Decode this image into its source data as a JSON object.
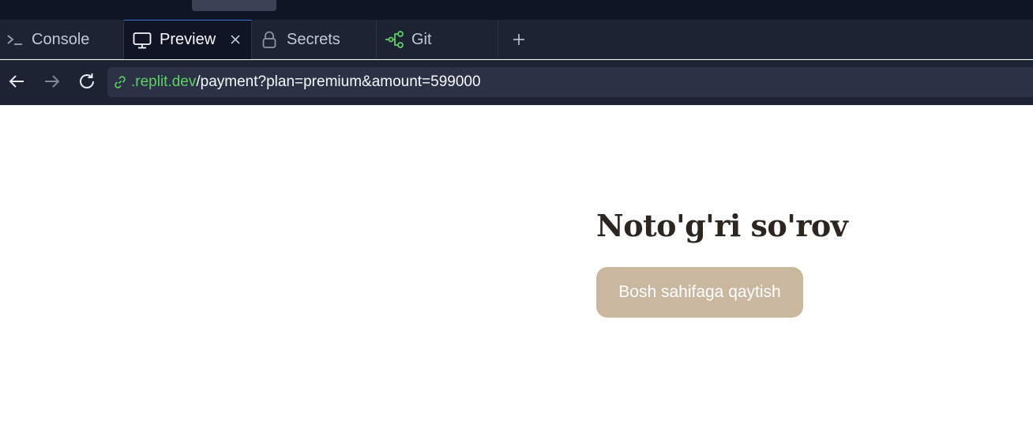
{
  "tabs": [
    {
      "label": "Console",
      "icon": "terminal-icon"
    },
    {
      "label": "Preview",
      "icon": "monitor-icon",
      "active": true
    },
    {
      "label": "Secrets",
      "icon": "lock-icon"
    },
    {
      "label": "Git",
      "icon": "git-branch-icon"
    }
  ],
  "add_tab_icon": "plus-icon",
  "close_tab_icon": "close-icon",
  "navigation": {
    "back_icon": "arrow-left-icon",
    "forward_icon": "arrow-right-icon",
    "reload_icon": "reload-icon"
  },
  "url": {
    "host": ".replit.dev",
    "path": "/payment?plan=premium&amount=599000"
  },
  "page": {
    "title": "Noto'g'ri so'rov",
    "button_label": "Bosh sahifaga qaytish"
  },
  "colors": {
    "accent_blue": "#3b74d8",
    "url_host_green": "#5fcf65",
    "button_beige": "#c9b79f",
    "title_dark": "#2e2521"
  }
}
